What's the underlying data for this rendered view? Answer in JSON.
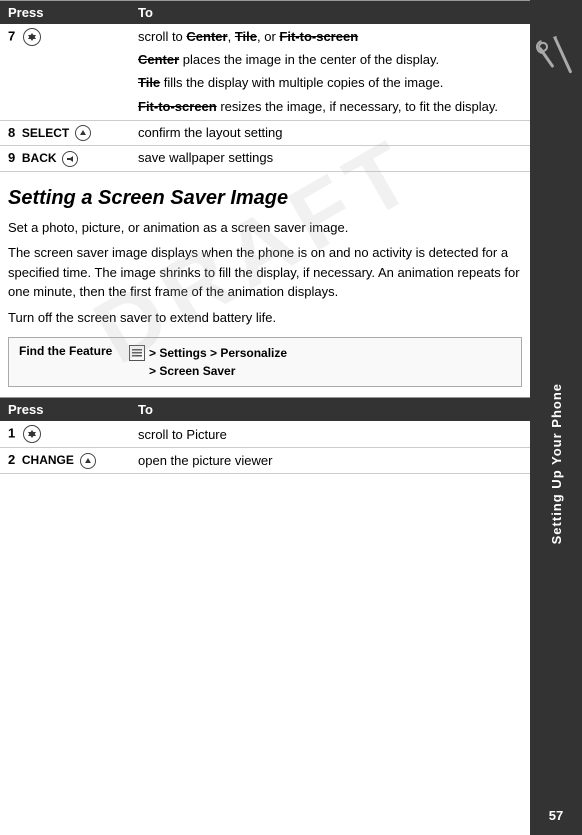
{
  "sidebar": {
    "icon_label": "tools-icon",
    "vertical_text": "Setting Up Your Phone",
    "page_number": "57"
  },
  "top_table": {
    "col1_header": "Press",
    "col2_header": "To",
    "rows": [
      {
        "id": "row-7",
        "press_num": "7",
        "press_icon": "scroll-nav-icon",
        "to_lines": [
          "scroll to Center, Tile, or Fit-to-screen",
          "Center places the image in the center of the display.",
          "Tile fills the display with multiple copies of the image.",
          "Fit-to-screen resizes the image, if necessary, to fit the display."
        ]
      },
      {
        "id": "row-8",
        "press_num": "8",
        "press_label": "SELECT",
        "press_icon": "select-btn-icon",
        "to_text": "confirm the layout setting"
      },
      {
        "id": "row-9",
        "press_num": "9",
        "press_label": "BACK",
        "press_icon": "back-btn-icon",
        "to_text": "save wallpaper settings"
      }
    ]
  },
  "section": {
    "heading": "Setting a Screen Saver Image",
    "paragraphs": [
      "Set a photo, picture, or animation as a screen saver image.",
      "The screen saver image displays when the phone is on and no activity is detected for a specified time. The image shrinks to fill the display, if necessary. An animation repeats for one minute, then the first frame of the animation displays.",
      "Turn off the screen saver to extend battery life."
    ]
  },
  "find_feature": {
    "label": "Find the Feature",
    "menu_icon": "menu-icon",
    "path": "> Settings > Personalize > Screen Saver"
  },
  "bottom_table": {
    "col1_header": "Press",
    "col2_header": "To",
    "rows": [
      {
        "id": "row-1",
        "press_num": "1",
        "press_icon": "scroll-nav-icon-2",
        "to_text": "scroll to Picture"
      },
      {
        "id": "row-2",
        "press_num": "2",
        "press_label": "CHANGE",
        "press_icon": "change-btn-icon",
        "to_text": "open the picture viewer"
      }
    ]
  },
  "draft_watermark": "DRAFT"
}
